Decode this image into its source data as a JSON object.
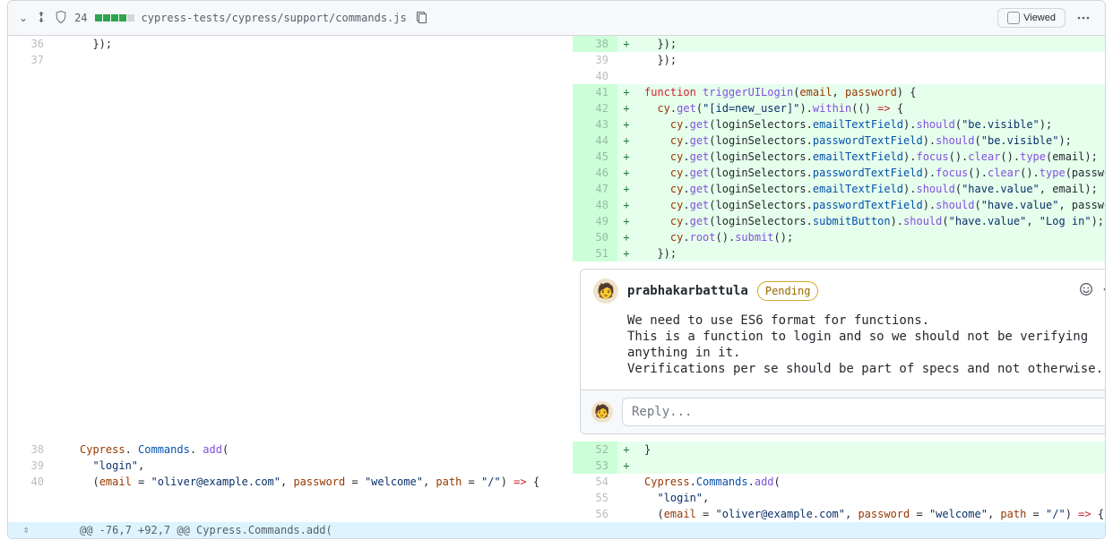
{
  "file_header": {
    "change_count": "24",
    "diff_blocks": 5,
    "path": "cypress-tests/cypress/support/commands.js",
    "viewed_label": "Viewed"
  },
  "left": {
    "rows": [
      {
        "num": "",
        "marker": "",
        "code": ""
      },
      {
        "num": "36",
        "marker": "",
        "code": "  });"
      },
      {
        "num": "37",
        "marker": "",
        "code": ""
      }
    ],
    "bottom_rows": [
      {
        "num": "38",
        "marker": "",
        "code": "Cypress.Commands.add(",
        "tokens": [
          [
            "k-var",
            "Cypress"
          ],
          [
            "",
            ". "
          ],
          "",
          [
            "k-prop",
            "Commands"
          ],
          [
            "",
            ". "
          ],
          [
            "k-func",
            "add"
          ],
          [
            "",
            "("
          ]
        ]
      },
      {
        "num": "39",
        "marker": "",
        "code": "  \"login\",",
        "tokens": [
          [
            "",
            "  "
          ],
          [
            "k-string",
            "\"login\""
          ],
          [
            "",
            ","
          ]
        ]
      },
      {
        "num": "40",
        "marker": "",
        "code": "  (email = \"oliver@example.com\", password = \"welcome\", path = \"/\") => {",
        "tokens": [
          [
            "",
            "  ("
          ],
          [
            "k-var",
            "email"
          ],
          [
            "",
            " = "
          ],
          [
            "k-string",
            "\"oliver@example.com\""
          ],
          [
            "",
            ", "
          ],
          [
            "k-var",
            "password"
          ],
          [
            "",
            " = "
          ],
          [
            "k-string",
            "\"welcome\""
          ],
          [
            "",
            ", "
          ],
          [
            "k-var",
            "path"
          ],
          [
            "",
            " = "
          ],
          [
            "k-string",
            "\"/\""
          ],
          [
            "",
            ") "
          ],
          [
            "k-keyword",
            "=>"
          ],
          [
            "",
            " {"
          ]
        ]
      }
    ]
  },
  "right": {
    "rows": [
      {
        "num": "",
        "marker": "",
        "add": false,
        "tokens": []
      },
      {
        "num": "38",
        "marker": "+",
        "add": true,
        "tokens": [
          [
            "",
            "  });"
          ]
        ]
      },
      {
        "num": "39",
        "marker": "",
        "add": false,
        "tokens": [
          [
            "",
            "  });"
          ]
        ]
      },
      {
        "num": "40",
        "marker": "",
        "add": false,
        "tokens": []
      },
      {
        "num": "41",
        "marker": "+",
        "add": true,
        "tokens": [
          [
            "k-keyword",
            "function"
          ],
          [
            "",
            " "
          ],
          [
            "k-func",
            "triggerUILogin"
          ],
          [
            "",
            "("
          ],
          [
            "k-var",
            "email"
          ],
          [
            "",
            ", "
          ],
          [
            "k-var",
            "password"
          ],
          [
            "",
            ") {"
          ]
        ]
      },
      {
        "num": "42",
        "marker": "+",
        "add": true,
        "tokens": [
          [
            "",
            "  "
          ],
          [
            "k-var",
            "cy"
          ],
          [
            "",
            "."
          ],
          [
            "k-func",
            "get"
          ],
          [
            "",
            "("
          ],
          [
            "k-string",
            "\"[id=new_user]\""
          ],
          [
            "",
            ")."
          ],
          [
            "k-func",
            "within"
          ],
          [
            "",
            "(() "
          ],
          [
            "k-keyword",
            "=>"
          ],
          [
            "",
            " {"
          ]
        ]
      },
      {
        "num": "43",
        "marker": "+",
        "add": true,
        "tokens": [
          [
            "",
            "    "
          ],
          [
            "k-var",
            "cy"
          ],
          [
            "",
            "."
          ],
          [
            "k-func",
            "get"
          ],
          [
            "",
            "(loginSelectors."
          ],
          [
            "k-prop",
            "emailTextField"
          ],
          [
            "",
            ")."
          ],
          [
            "k-func",
            "should"
          ],
          [
            "",
            "("
          ],
          [
            "k-string",
            "\"be.visible\""
          ],
          [
            "",
            ");"
          ]
        ]
      },
      {
        "num": "44",
        "marker": "+",
        "add": true,
        "tokens": [
          [
            "",
            "    "
          ],
          [
            "k-var",
            "cy"
          ],
          [
            "",
            "."
          ],
          [
            "k-func",
            "get"
          ],
          [
            "",
            "(loginSelectors."
          ],
          [
            "k-prop",
            "passwordTextField"
          ],
          [
            "",
            ")."
          ],
          [
            "k-func",
            "should"
          ],
          [
            "",
            "("
          ],
          [
            "k-string",
            "\"be.visible\""
          ],
          [
            "",
            ");"
          ]
        ]
      },
      {
        "num": "45",
        "marker": "+",
        "add": true,
        "tokens": [
          [
            "",
            "    "
          ],
          [
            "k-var",
            "cy"
          ],
          [
            "",
            "."
          ],
          [
            "k-func",
            "get"
          ],
          [
            "",
            "(loginSelectors."
          ],
          [
            "k-prop",
            "emailTextField"
          ],
          [
            "",
            ")."
          ],
          [
            "k-func",
            "focus"
          ],
          [
            "",
            "()."
          ],
          [
            "k-func",
            "clear"
          ],
          [
            "",
            "()."
          ],
          [
            "k-func",
            "type"
          ],
          [
            "",
            "(email);"
          ]
        ]
      },
      {
        "num": "46",
        "marker": "+",
        "add": true,
        "tokens": [
          [
            "",
            "    "
          ],
          [
            "k-var",
            "cy"
          ],
          [
            "",
            "."
          ],
          [
            "k-func",
            "get"
          ],
          [
            "",
            "(loginSelectors."
          ],
          [
            "k-prop",
            "passwordTextField"
          ],
          [
            "",
            ")."
          ],
          [
            "k-func",
            "focus"
          ],
          [
            "",
            "()."
          ],
          [
            "k-func",
            "clear"
          ],
          [
            "",
            "()."
          ],
          [
            "k-func",
            "type"
          ],
          [
            "",
            "(password);"
          ]
        ]
      },
      {
        "num": "47",
        "marker": "+",
        "add": true,
        "tokens": [
          [
            "",
            "    "
          ],
          [
            "k-var",
            "cy"
          ],
          [
            "",
            "."
          ],
          [
            "k-func",
            "get"
          ],
          [
            "",
            "(loginSelectors."
          ],
          [
            "k-prop",
            "emailTextField"
          ],
          [
            "",
            ")."
          ],
          [
            "k-func",
            "should"
          ],
          [
            "",
            "("
          ],
          [
            "k-string",
            "\"have.value\""
          ],
          [
            "",
            ", email);"
          ]
        ]
      },
      {
        "num": "48",
        "marker": "+",
        "add": true,
        "tokens": [
          [
            "",
            "    "
          ],
          [
            "k-var",
            "cy"
          ],
          [
            "",
            "."
          ],
          [
            "k-func",
            "get"
          ],
          [
            "",
            "(loginSelectors."
          ],
          [
            "k-prop",
            "passwordTextField"
          ],
          [
            "",
            ")."
          ],
          [
            "k-func",
            "should"
          ],
          [
            "",
            "("
          ],
          [
            "k-string",
            "\"have.value\""
          ],
          [
            "",
            ", password);"
          ]
        ]
      },
      {
        "num": "49",
        "marker": "+",
        "add": true,
        "tokens": [
          [
            "",
            "    "
          ],
          [
            "k-var",
            "cy"
          ],
          [
            "",
            "."
          ],
          [
            "k-func",
            "get"
          ],
          [
            "",
            "(loginSelectors."
          ],
          [
            "k-prop",
            "submitButton"
          ],
          [
            "",
            ")."
          ],
          [
            "k-func",
            "should"
          ],
          [
            "",
            "("
          ],
          [
            "k-string",
            "\"have.value\""
          ],
          [
            "",
            ", "
          ],
          [
            "k-string",
            "\"Log in\""
          ],
          [
            "",
            ");"
          ]
        ]
      },
      {
        "num": "50",
        "marker": "+",
        "add": true,
        "tokens": [
          [
            "",
            "    "
          ],
          [
            "k-var",
            "cy"
          ],
          [
            "",
            "."
          ],
          [
            "k-func",
            "root"
          ],
          [
            "",
            "()."
          ],
          [
            "k-func",
            "submit"
          ],
          [
            "",
            "();"
          ]
        ]
      },
      {
        "num": "51",
        "marker": "+",
        "add": true,
        "tokens": [
          [
            "",
            "  });"
          ]
        ]
      }
    ],
    "bottom_rows": [
      {
        "num": "52",
        "marker": "+",
        "add": true,
        "tokens": [
          [
            "",
            "}"
          ]
        ]
      },
      {
        "num": "53",
        "marker": "+",
        "add": true,
        "tokens": []
      },
      {
        "num": "54",
        "marker": "",
        "add": false,
        "tokens": [
          [
            "k-var",
            "Cypress"
          ],
          [
            "",
            "."
          ],
          [
            "k-prop",
            "Commands"
          ],
          [
            "",
            "."
          ],
          [
            "k-func",
            "add"
          ],
          [
            "",
            "("
          ]
        ]
      },
      {
        "num": "55",
        "marker": "",
        "add": false,
        "tokens": [
          [
            "",
            "  "
          ],
          [
            "k-string",
            "\"login\""
          ],
          [
            "",
            ","
          ]
        ]
      },
      {
        "num": "56",
        "marker": "",
        "add": false,
        "tokens": [
          [
            "",
            "  ("
          ],
          [
            "k-var",
            "email"
          ],
          [
            "",
            " = "
          ],
          [
            "k-string",
            "\"oliver@example.com\""
          ],
          [
            "",
            ", "
          ],
          [
            "k-var",
            "password"
          ],
          [
            "",
            " = "
          ],
          [
            "k-string",
            "\"welcome\""
          ],
          [
            "",
            ", "
          ],
          [
            "k-var",
            "path"
          ],
          [
            "",
            " = "
          ],
          [
            "k-string",
            "\"/\""
          ],
          [
            "",
            ") "
          ],
          [
            "k-keyword",
            "=>"
          ],
          [
            "",
            " {"
          ]
        ]
      }
    ]
  },
  "comment": {
    "author": "prabhakarbattula",
    "badge": "Pending",
    "body_lines": [
      "We need to use ES6 format for functions.",
      "This is a function to login and so we should not be verifying anything in it.",
      "Verifications per se should be part of specs and not otherwise."
    ],
    "reply_placeholder": "Reply..."
  },
  "hunk": {
    "text": "@@ -76,7 +92,7 @@ Cypress.Commands.add("
  }
}
